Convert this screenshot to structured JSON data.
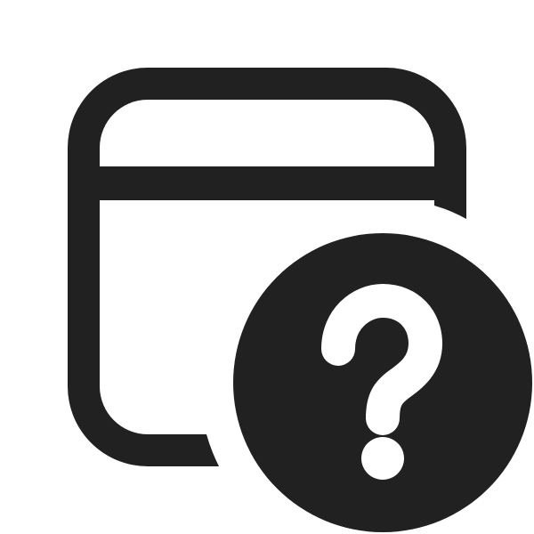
{
  "icon": {
    "name": "calendar-question-mark-icon",
    "parts": [
      "window-frame",
      "title-bar",
      "question-circle",
      "question-mark"
    ],
    "colors": {
      "foreground": "#212121",
      "background": "#ffffff"
    }
  }
}
